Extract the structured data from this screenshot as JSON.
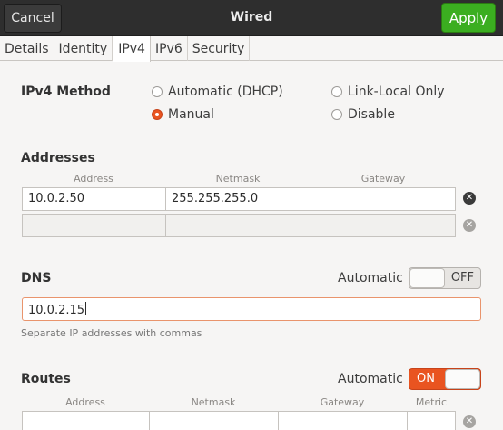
{
  "header": {
    "title": "Wired",
    "cancel_label": "Cancel",
    "apply_label": "Apply"
  },
  "tabs": [
    {
      "label": "Details"
    },
    {
      "label": "Identity"
    },
    {
      "label": "IPv4",
      "active": true
    },
    {
      "label": "IPv6"
    },
    {
      "label": "Security"
    }
  ],
  "ipv4_method": {
    "label": "IPv4 Method",
    "options": [
      "Automatic (DHCP)",
      "Manual",
      "Link-Local Only",
      "Disable"
    ],
    "selected": "Manual"
  },
  "addresses": {
    "label": "Addresses",
    "columns": [
      "Address",
      "Netmask",
      "Gateway"
    ],
    "rows": [
      {
        "address": "10.0.2.50",
        "netmask": "255.255.255.0",
        "gateway": ""
      },
      {
        "address": "",
        "netmask": "",
        "gateway": ""
      }
    ]
  },
  "dns": {
    "label": "DNS",
    "automatic_label": "Automatic",
    "switch_state": "OFF",
    "value": "10.0.2.15",
    "hint": "Separate IP addresses with commas"
  },
  "routes": {
    "label": "Routes",
    "automatic_label": "Automatic",
    "switch_state": "ON",
    "columns": [
      "Address",
      "Netmask",
      "Gateway",
      "Metric"
    ]
  },
  "colors": {
    "accent": "#e95420",
    "apply": "#3bae20",
    "header": "#2e2e2e"
  }
}
